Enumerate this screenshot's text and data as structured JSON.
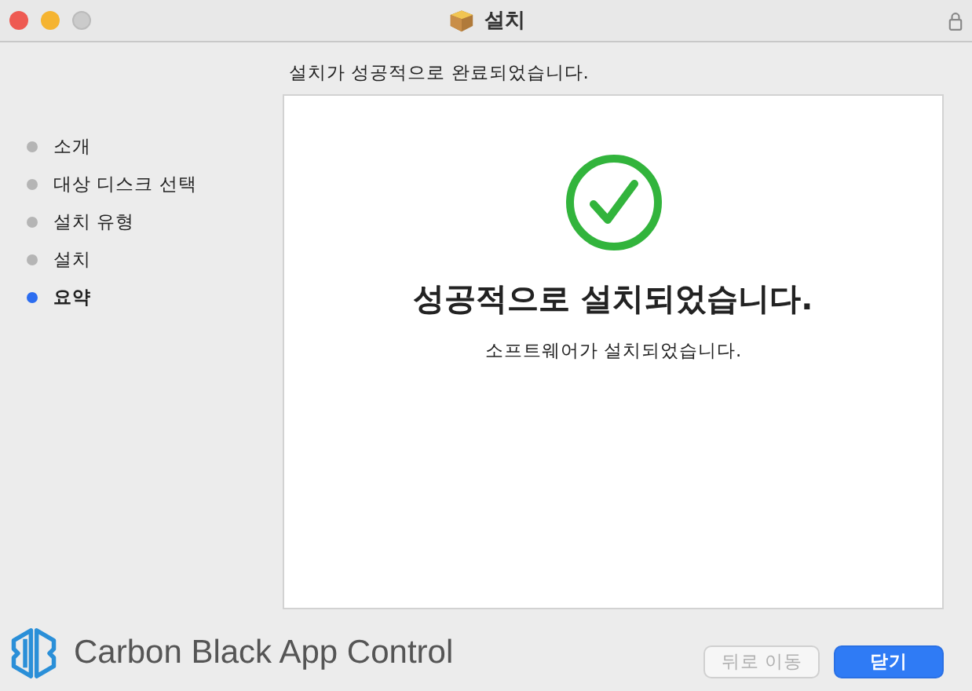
{
  "window": {
    "title": "설치"
  },
  "heading": "설치가 성공적으로 완료되었습니다.",
  "steps": [
    {
      "label": "소개",
      "selected": false
    },
    {
      "label": "대상 디스크 선택",
      "selected": false
    },
    {
      "label": "설치 유형",
      "selected": false
    },
    {
      "label": "설치",
      "selected": false
    },
    {
      "label": "요약",
      "selected": true
    }
  ],
  "result": {
    "title": "성공적으로 설치되었습니다.",
    "message": "소프트웨어가 설치되었습니다."
  },
  "brand": "Carbon Black App Control",
  "buttons": [
    {
      "label": "뒤로 이동",
      "kind": "secondary",
      "disabled": true
    },
    {
      "label": "닫기",
      "kind": "primary",
      "disabled": false
    }
  ]
}
